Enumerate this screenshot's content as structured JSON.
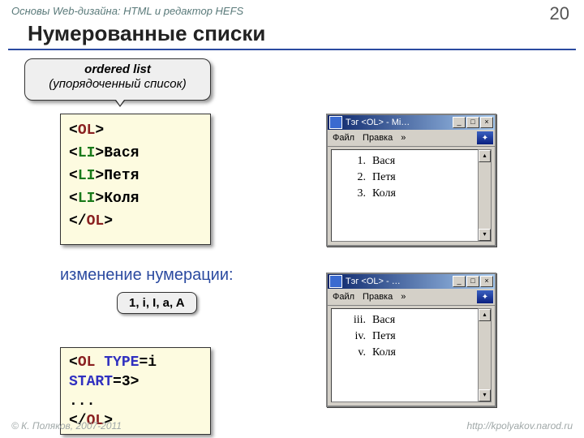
{
  "header": {
    "breadcrumb": "Основы Web-дизайна: HTML и редактор HEFS",
    "page_number": "20",
    "title": "Нумерованные списки"
  },
  "bubble": {
    "line1": "ordered list",
    "line2": "(упорядоченный список)"
  },
  "code1": {
    "open_tag_angle": "<",
    "open_tag_name": "OL",
    "open_tag_close": ">",
    "li_angle": "<",
    "li_name": "LI",
    "li_close": ">",
    "item1": "Вася",
    "item2": "Петя",
    "item3": "Коля",
    "end_angle": "</",
    "end_name": "OL",
    "end_close": ">"
  },
  "subhead": "изменение нумерации:",
  "chip": "1, i, I, a, A",
  "code2": {
    "l1_a": "<",
    "l1_b": "OL ",
    "l1_c": "TYPE",
    "l1_d": "=i",
    "l2_a": "START",
    "l2_b": "=3>",
    "l3": "...",
    "l4_a": "</",
    "l4_b": "OL",
    "l4_c": ">"
  },
  "win1": {
    "title": "Тэг <OL> - Mi…",
    "menu_file": "Файл",
    "menu_edit": "Правка",
    "items": [
      {
        "num": "1.",
        "name": "Вася"
      },
      {
        "num": "2.",
        "name": "Петя"
      },
      {
        "num": "3.",
        "name": "Коля"
      }
    ]
  },
  "win2": {
    "title": "Тэг <OL> - …",
    "menu_file": "Файл",
    "menu_edit": "Правка",
    "items": [
      {
        "num": "iii.",
        "name": "Вася"
      },
      {
        "num": "iv.",
        "name": "Петя"
      },
      {
        "num": "v.",
        "name": "Коля"
      }
    ]
  },
  "footer": {
    "left": "© К. Поляков, 2007-2011",
    "right": "http://kpolyakov.narod.ru"
  }
}
